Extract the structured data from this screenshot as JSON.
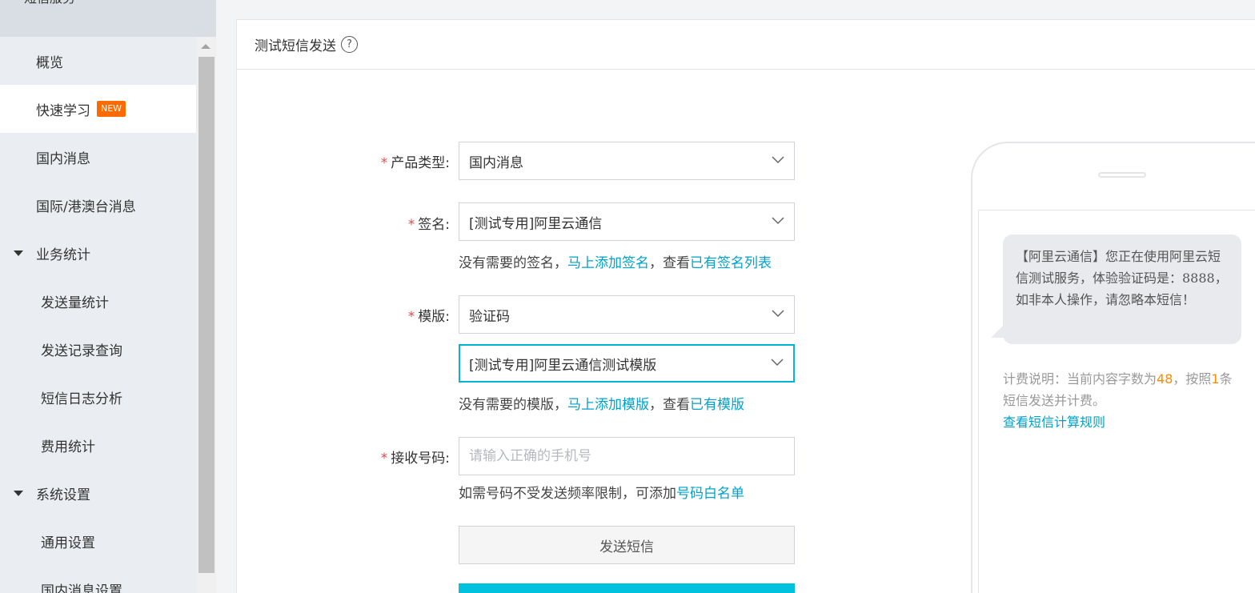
{
  "sidebar": {
    "header_title": "短信服务",
    "items": [
      {
        "label": "概览"
      },
      {
        "label": "快速学习",
        "badge": "NEW"
      },
      {
        "label": "国内消息"
      },
      {
        "label": "国际/港澳台消息"
      }
    ],
    "groups": [
      {
        "label": "业务统计",
        "children": [
          "发送量统计",
          "发送记录查询",
          "短信日志分析",
          "费用统计"
        ]
      },
      {
        "label": "系统设置",
        "children": [
          "通用设置",
          "国内消息设置"
        ]
      }
    ]
  },
  "card": {
    "title": "测试短信发送",
    "help": "?"
  },
  "form": {
    "product_type": {
      "label": "产品类型:",
      "value": "国内消息"
    },
    "signature": {
      "label": "签名:",
      "value": "[测试专用]阿里云通信",
      "hint_prefix": "没有需要的签名，",
      "hint_link1": "马上添加签名",
      "hint_middle": "，查看",
      "hint_link2": "已有签名列表"
    },
    "template": {
      "label": "模版:",
      "type_value": "验证码",
      "value": "[测试专用]阿里云通信测试模版",
      "hint_prefix": "没有需要的模版，",
      "hint_link1": "马上添加模版",
      "hint_middle": "，查看",
      "hint_link2": "已有模版"
    },
    "phone": {
      "label": "接收号码:",
      "placeholder": "请输入正确的手机号",
      "hint_prefix": "如需号码不受发送频率限制，可添加",
      "hint_link": "号码白名单"
    },
    "required_mark": "*",
    "send_button": "发送短信"
  },
  "preview": {
    "message": "【阿里云通信】您正在使用阿里云短信测试服务，体验验证码是：8888，如非本人操作，请忽略本短信！",
    "billing_prefix": "计费说明：当前内容字数为",
    "char_count": "48",
    "billing_middle": "，按照",
    "sms_count": "1",
    "billing_suffix": "条短信发送并计费。",
    "rules_link": "查看短信计算规则"
  },
  "colors": {
    "accent": "#00c1de",
    "link": "#00a2ca",
    "badge": "#ff6a00",
    "required": "#e04c4c"
  }
}
